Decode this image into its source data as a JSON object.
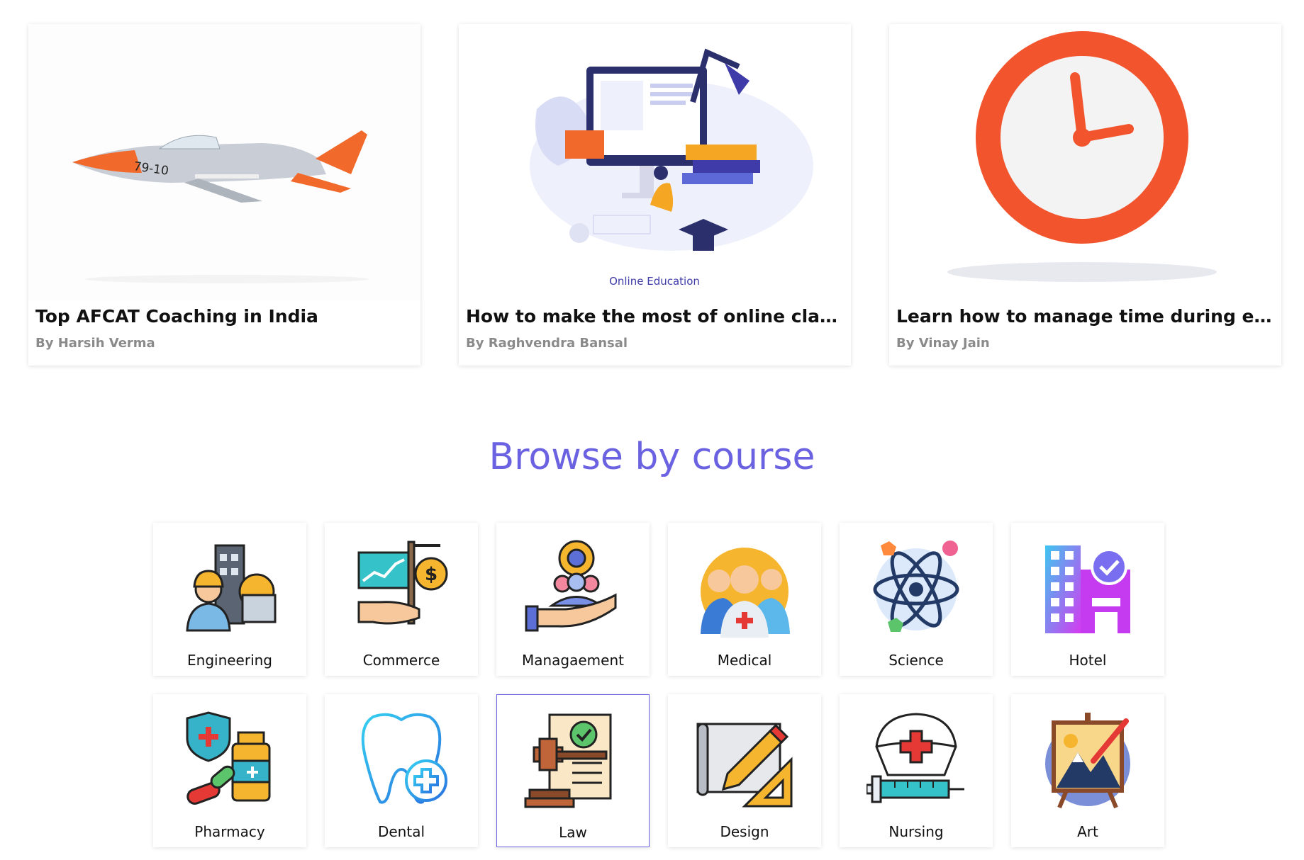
{
  "articles": [
    {
      "title": "Top AFCAT Coaching in India",
      "author": "By Harsih Verma",
      "image_label": "79-10"
    },
    {
      "title": "How to make the most of online classes",
      "author": "By Raghvendra Bansal",
      "image_label": "Online Education"
    },
    {
      "title": "Learn how to manage time during exa...",
      "author": "By Vinay Jain"
    }
  ],
  "browse": {
    "heading": "Browse by course",
    "courses": [
      {
        "label": "Engineering",
        "icon": "engineer-icon"
      },
      {
        "label": "Commerce",
        "icon": "commerce-icon"
      },
      {
        "label": "Managaement",
        "icon": "management-icon"
      },
      {
        "label": "Medical",
        "icon": "medical-team-icon"
      },
      {
        "label": "Science",
        "icon": "atom-icon"
      },
      {
        "label": "Hotel",
        "icon": "hotel-icon"
      },
      {
        "label": "Pharmacy",
        "icon": "pharmacy-icon"
      },
      {
        "label": "Dental",
        "icon": "tooth-icon"
      },
      {
        "label": "Law",
        "icon": "gavel-icon",
        "selected": true
      },
      {
        "label": "Design",
        "icon": "pencil-ruler-icon"
      },
      {
        "label": "Nursing",
        "icon": "nurse-cap-icon"
      },
      {
        "label": "Art",
        "icon": "easel-icon"
      }
    ]
  },
  "colors": {
    "heading": "#6a62e0",
    "author": "#8a8a8a",
    "selected_border": "#6a62e0"
  }
}
